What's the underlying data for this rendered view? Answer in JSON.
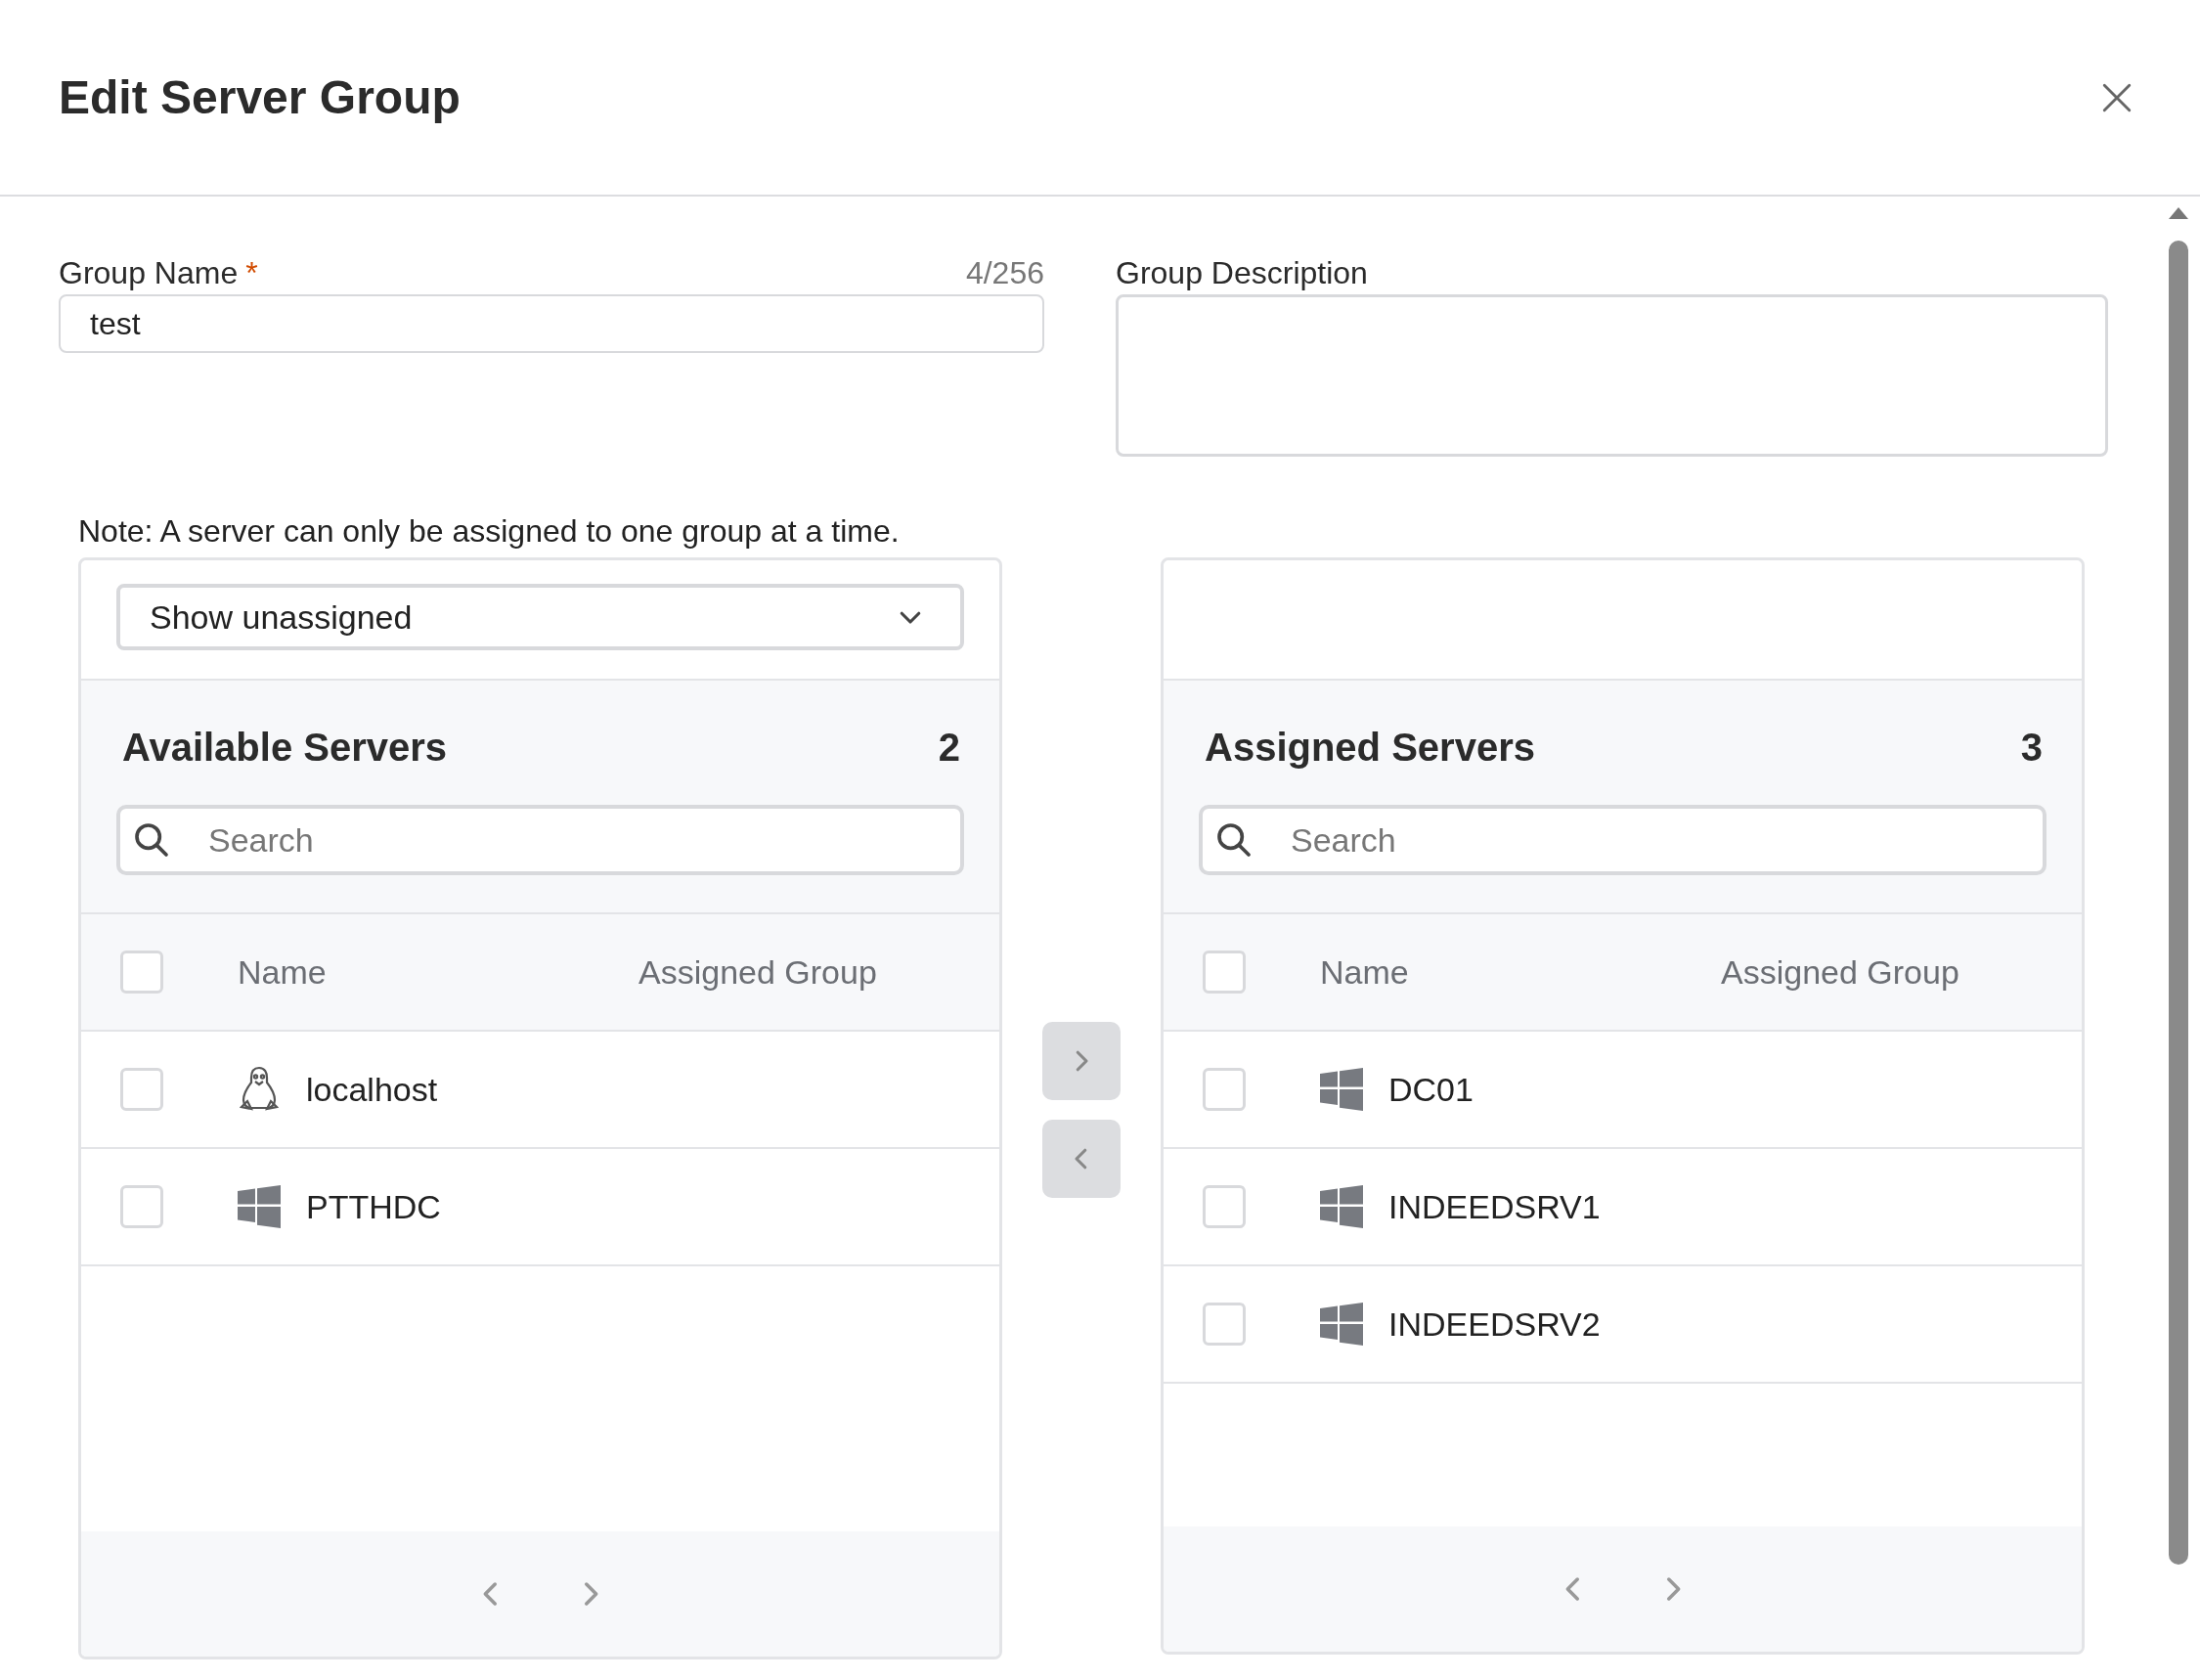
{
  "dialog": {
    "title": "Edit Server Group"
  },
  "form": {
    "group_name": {
      "label": "Group Name",
      "required_mark": "*",
      "counter": "4/256",
      "value": "test"
    },
    "group_description": {
      "label": "Group Description"
    }
  },
  "note": "Note: A server can only be assigned to one group at a time.",
  "panels": [
    {
      "filter": {
        "value": "Show unassigned"
      },
      "title": "Available Servers",
      "count": "2",
      "search": {
        "placeholder": "Search"
      },
      "all_checked": false,
      "columns": [
        "Name",
        "Assigned Group"
      ],
      "rows": [
        {
          "name": "localhost",
          "kind": "linux",
          "checked": false
        },
        {
          "name": "PTTHDC",
          "kind": "windows",
          "checked": false
        }
      ]
    },
    {
      "title": "Assigned Servers",
      "count": "3",
      "search": {
        "placeholder": "Search"
      },
      "all_checked": false,
      "columns": [
        "Name",
        "Assigned Group"
      ],
      "rows": [
        {
          "name": "DC01",
          "kind": "windows",
          "checked": false
        },
        {
          "name": "INDEEDSRV1",
          "kind": "windows",
          "checked": false
        },
        {
          "name": "INDEEDSRV2",
          "kind": "windows",
          "checked": false
        }
      ]
    }
  ]
}
